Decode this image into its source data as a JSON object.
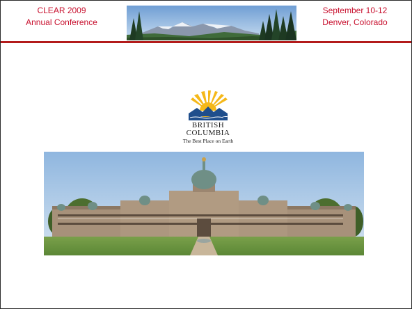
{
  "header": {
    "left_line1": "CLEAR 2009",
    "left_line2": "Annual Conference",
    "right_line1": "September 10-12",
    "right_line2": "Denver, Colorado"
  },
  "logo": {
    "line1": "BRITISH",
    "line2": "COLUMBIA",
    "tagline": "The Best Place on Earth"
  },
  "colors": {
    "header_text": "#c8102e",
    "header_rule": "#b31b1b",
    "logo_sun": "#f5b819",
    "logo_blue": "#1f4e8c"
  },
  "icons": {
    "mountain_photo": "mountain-landscape-photo",
    "parliament_photo": "parliament-building-photo",
    "bc_logo": "bc-sun-mountains-logo"
  }
}
